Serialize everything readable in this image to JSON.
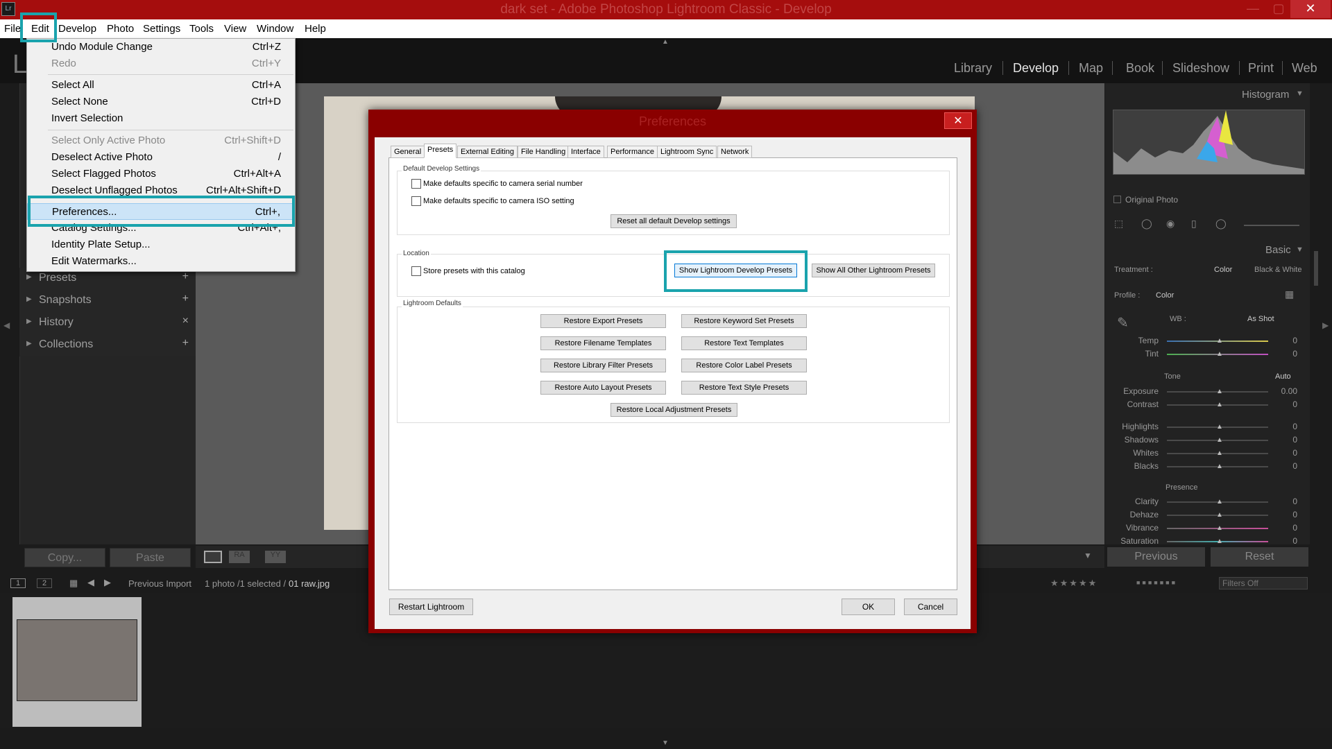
{
  "window": {
    "title": "dark set - Adobe Photoshop Lightroom Classic - Develop",
    "app_icon": "Lr",
    "minimize": "—",
    "maximize": "▢",
    "close": "✕"
  },
  "menubar": [
    "File",
    "Edit",
    "Develop",
    "Photo",
    "Settings",
    "Tools",
    "View",
    "Window",
    "Help"
  ],
  "edit_menu": [
    {
      "label": "Undo Module Change",
      "shortcut": "Ctrl+Z",
      "disabled": false
    },
    {
      "label": "Redo",
      "shortcut": "Ctrl+Y",
      "disabled": true
    },
    {
      "label": "Select All",
      "shortcut": "Ctrl+A",
      "disabled": false
    },
    {
      "label": "Select None",
      "shortcut": "Ctrl+D",
      "disabled": false
    },
    {
      "label": "Invert Selection",
      "shortcut": "",
      "disabled": false
    },
    {
      "label": "Select Only Active Photo",
      "shortcut": "Ctrl+Shift+D",
      "disabled": true
    },
    {
      "label": "Deselect Active Photo",
      "shortcut": "/",
      "disabled": false
    },
    {
      "label": "Select Flagged Photos",
      "shortcut": "Ctrl+Alt+A",
      "disabled": false
    },
    {
      "label": "Deselect Unflagged Photos",
      "shortcut": "Ctrl+Alt+Shift+D",
      "disabled": false
    },
    {
      "label": "Preferences...",
      "shortcut": "Ctrl+,",
      "disabled": false
    },
    {
      "label": "Catalog Settings...",
      "shortcut": "Ctrl+Alt+,",
      "disabled": false
    },
    {
      "label": "Identity Plate Setup...",
      "shortcut": "",
      "disabled": false
    },
    {
      "label": "Edit Watermarks...",
      "shortcut": "",
      "disabled": false
    }
  ],
  "modules": [
    "Library",
    "Develop",
    "Map",
    "Book",
    "Slideshow",
    "Print",
    "Web"
  ],
  "active_module": "Develop",
  "left_panels": [
    {
      "label": "Presets",
      "action": "+"
    },
    {
      "label": "Snapshots",
      "action": "+"
    },
    {
      "label": "History",
      "action": "×"
    },
    {
      "label": "Collections",
      "action": "+"
    }
  ],
  "left_buttons": {
    "copy": "Copy...",
    "paste": "Paste"
  },
  "right_panel": {
    "histogram": "Histogram",
    "original_photo": "Original Photo",
    "basic": "Basic",
    "treatment_label": "Treatment :",
    "treatment_color": "Color",
    "treatment_bw": "Black & White",
    "profile_label": "Profile :",
    "profile_value": "Color",
    "wb_label": "WB :",
    "wb_value": "As Shot",
    "tone_label": "Tone",
    "auto_label": "Auto",
    "presence_label": "Presence",
    "sliders": [
      {
        "label": "Temp",
        "value": "0"
      },
      {
        "label": "Tint",
        "value": "0"
      },
      {
        "label": "Exposure",
        "value": "0.00"
      },
      {
        "label": "Contrast",
        "value": "0"
      },
      {
        "label": "Highlights",
        "value": "0"
      },
      {
        "label": "Shadows",
        "value": "0"
      },
      {
        "label": "Whites",
        "value": "0"
      },
      {
        "label": "Blacks",
        "value": "0"
      },
      {
        "label": "Clarity",
        "value": "0"
      },
      {
        "label": "Dehaze",
        "value": "0"
      },
      {
        "label": "Vibrance",
        "value": "0"
      },
      {
        "label": "Saturation",
        "value": "0"
      }
    ],
    "previous": "Previous",
    "reset": "Reset"
  },
  "filmstrip": {
    "screen1": "1",
    "screen2": "2",
    "source": "Previous Import",
    "info": "1 photo /1 selected /",
    "filename": "01 raw.jpg",
    "filter": "Filters Off"
  },
  "dialog": {
    "title": "Preferences",
    "tabs": [
      "General",
      "Presets",
      "External Editing",
      "File Handling",
      "Interface",
      "Performance",
      "Lightroom Sync",
      "Network"
    ],
    "active_tab": "Presets",
    "default_develop_label": "Default Develop Settings",
    "cb_serial": "Make defaults specific to camera serial number",
    "cb_iso": "Make defaults specific to camera ISO setting",
    "reset_all": "Reset all default Develop settings",
    "location_label": "Location",
    "cb_store": "Store presets with this catalog",
    "show_develop": "Show Lightroom Develop Presets",
    "show_other": "Show All Other Lightroom Presets",
    "defaults_label": "Lightroom Defaults",
    "restore_buttons": [
      "Restore Export Presets",
      "Restore Keyword Set Presets",
      "Restore Filename Templates",
      "Restore Text Templates",
      "Restore Library Filter Presets",
      "Restore Color Label Presets",
      "Restore Auto Layout Presets",
      "Restore Text Style Presets"
    ],
    "restore_local": "Restore Local Adjustment Presets",
    "restart": "Restart Lightroom",
    "ok": "OK",
    "cancel": "Cancel"
  },
  "colors": {
    "highlight": "#1aa3ad",
    "titlebar": "#a50d0d",
    "dialog_frame": "#8a0000"
  }
}
